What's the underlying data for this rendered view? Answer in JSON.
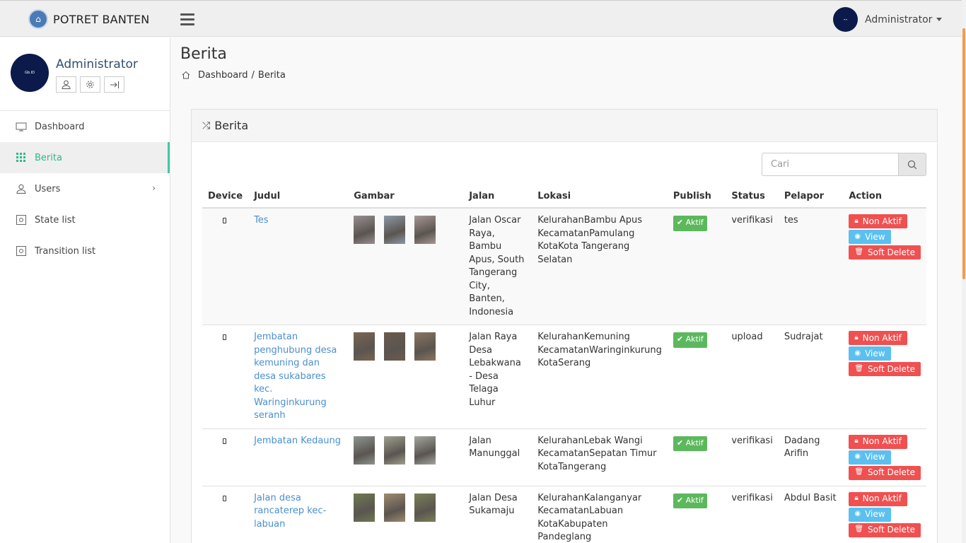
{
  "brand": {
    "name": "POTRET BANTEN"
  },
  "topbar": {
    "user_name": "Administrator",
    "avatar_text": "--"
  },
  "sidebar": {
    "profile_name": "Administrator",
    "avatar_text": "Gb.ID",
    "items": [
      {
        "label": "Dashboard",
        "icon": "monitor-icon"
      },
      {
        "label": "Berita",
        "icon": "grid-icon"
      },
      {
        "label": "Users",
        "icon": "user-icon"
      },
      {
        "label": "State list",
        "icon": "gear-icon"
      },
      {
        "label": "Transition list",
        "icon": "gear-icon"
      }
    ]
  },
  "page": {
    "title": "Berita"
  },
  "breadcrumb": {
    "home": "Dashboard",
    "current": "Berita"
  },
  "panel": {
    "title": "Berita",
    "search_placeholder": "Cari"
  },
  "table": {
    "headers": [
      "Device",
      "Judul",
      "Gambar",
      "Jalan",
      "Lokasi",
      "Publish",
      "Status",
      "Pelapor",
      "Action"
    ],
    "action_labels": {
      "non_aktif": "Non Aktif",
      "view": "View",
      "soft_delete": "Soft Delete"
    },
    "rows": [
      {
        "judul": "Tes",
        "jalan": "Jalan Oscar Raya, Bambu Apus, South Tangerang City, Banten, Indonesia",
        "lokasi": [
          "KelurahanBambu Apus",
          "KecamatanPamulang",
          "KotaKota Tangerang Selatan"
        ],
        "publish": "Aktif",
        "status": "verifikasi",
        "pelapor": "tes",
        "thumb_colors": [
          "#9a8f92",
          "#8d98a6",
          "#a89794"
        ]
      },
      {
        "judul": "Jembatan penghubung desa kemuning dan desa sukabares kec. Waringinkurung seranh",
        "jalan": "Jalan Raya Desa Lebakwana - Desa Telaga Luhur",
        "lokasi": [
          "KelurahanKemuning",
          "KecamatanWaringinkurung",
          "KotaSerang"
        ],
        "publish": "Aktif",
        "status": "upload",
        "pelapor": "Sudrajat",
        "thumb_colors": [
          "#7b6452",
          "#6a5a4e",
          "#8a7560"
        ]
      },
      {
        "judul": "Jembatan Kedaung",
        "jalan": "Jalan Manunggal",
        "lokasi": [
          "KelurahanLebak Wangi",
          "KecamatanSepatan Timur",
          "KotaTangerang"
        ],
        "publish": "Aktif",
        "status": "verifikasi",
        "pelapor": "Dadang Arifin",
        "thumb_colors": [
          "#8e9490",
          "#9ea08e",
          "#a3a79f"
        ]
      },
      {
        "judul": "Jalan desa rancaterep kec-labuan",
        "jalan": "Jalan Desa Sukamaju",
        "lokasi": [
          "KelurahanKalanganyar",
          "KecamatanLabuan",
          "KotaKabupaten Pandeglang"
        ],
        "publish": "Aktif",
        "status": "verifikasi",
        "pelapor": "Abdul Basit",
        "thumb_colors": [
          "#6e7a4f",
          "#a08a6e",
          "#7a8058"
        ]
      }
    ]
  }
}
